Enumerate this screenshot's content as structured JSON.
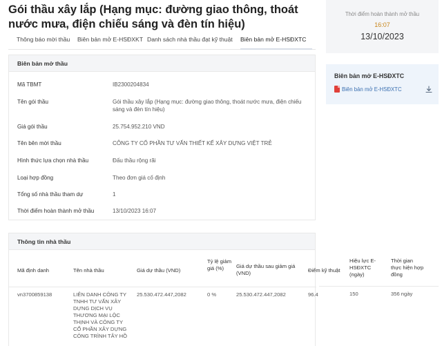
{
  "page": {
    "title": "Gói thầu xây lắp (Hạng mục: đường giao thông, thoát nước mưa, điện chiếu sáng và đèn tín hiệu)"
  },
  "tabs": [
    {
      "label": "Thông báo mời thầu"
    },
    {
      "label": "Biên bản mở E-HSĐXKT"
    },
    {
      "label": "Danh sách nhà thầu đạt kỹ thuật"
    },
    {
      "label": "Biên bản mở E-HSĐXTC"
    }
  ],
  "opening_minutes": {
    "heading": "Biên bản mở thầu",
    "rows": [
      {
        "key": "Mã TBMT",
        "value": "IB2300204834"
      },
      {
        "key": "Tên gói thầu",
        "value": "Gói thầu xây lắp (Hạng mục: đường giao thông, thoát nước mưa, điện chiếu sáng và đèn tín hiệu)"
      },
      {
        "key": "Giá gói thầu",
        "value": "25.754.952.210 VND"
      },
      {
        "key": "Tên bên mời thầu",
        "value": "CÔNG TY CỔ PHẦN TƯ VẤN THIẾT KẾ XÂY DỰNG VIỆT TRẺ"
      },
      {
        "key": "Hình thức lựa chọn nhà thầu",
        "value": "Đấu thầu rộng rãi"
      },
      {
        "key": "Loại hợp đồng",
        "value": "Theo đơn giá cố định"
      },
      {
        "key": "Tổng số nhà thầu tham dự",
        "value": "1"
      },
      {
        "key": "Thời điểm hoàn thành mở thầu",
        "value": "13/10/2023 16:07"
      }
    ]
  },
  "contractors": {
    "heading": "Thông tin nhà thầu",
    "columns": [
      "Mã định danh",
      "Tên nhà thầu",
      "Giá dự thầu (VND)",
      "Tỷ lệ giảm giá (%)",
      "Giá dự thầu sau giảm giá (VND)",
      "Điểm kỹ thuật",
      "Hiệu lực E-HSĐXTC (ngày)",
      "Thời gian thực hiện hợp đồng"
    ],
    "rows": [
      {
        "id": "vn3700859138",
        "name": "LIÊN DANH CÔNG TY TNHH TƯ VẤN XÂY DỰNG DỊCH VỤ THƯƠNG MẠI LỘC THỊNH VÀ CÔNG TY CỔ PHẦN XÂY DỰNG CÔNG TRÌNH TÂY HỒ",
        "bid_price": "25.530.472.447,2082",
        "discount": "0 %",
        "price_after_discount": "25.530.472.447,2082",
        "technical_score": "96.4",
        "validity_days": "150",
        "duration": "356 ngày"
      }
    ]
  },
  "completion": {
    "label": "Thời điểm hoàn thành mở thầu",
    "time": "16:07",
    "date": "13/10/2023"
  },
  "download": {
    "title": "Biên bản mở E-HSĐXTC",
    "file_label": "Biên bản mở E-HSĐXTC"
  },
  "colors": {
    "accent_time": "#c9861b",
    "link": "#3a6fb0",
    "pdf": "#e0403a"
  }
}
